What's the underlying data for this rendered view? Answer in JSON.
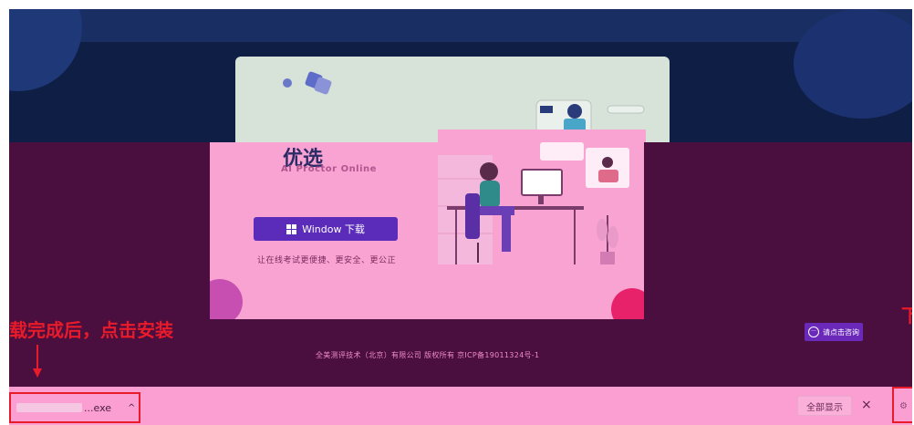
{
  "card": {
    "logo_text": "优选",
    "logo_sub": "AI Proctor Online",
    "download_label": "Window 下载",
    "slogan": "让在线考试更便捷、更安全、更公正"
  },
  "footer": {
    "copyright": "全美测评技术（北京）有限公司 版权所有 京ICP备19011324号-1"
  },
  "chat": {
    "label": "请点击咨询"
  },
  "annotation": {
    "left_text": "载完成后，点击安装",
    "right_text": "下"
  },
  "download_bar": {
    "file_ext": "...exe",
    "caret": "^",
    "show_all": "全部显示",
    "close": "×"
  },
  "icons": [
    "windows-icon",
    "chat-icon",
    "close-icon",
    "chevron-up-icon",
    "arrow-down-icon"
  ]
}
